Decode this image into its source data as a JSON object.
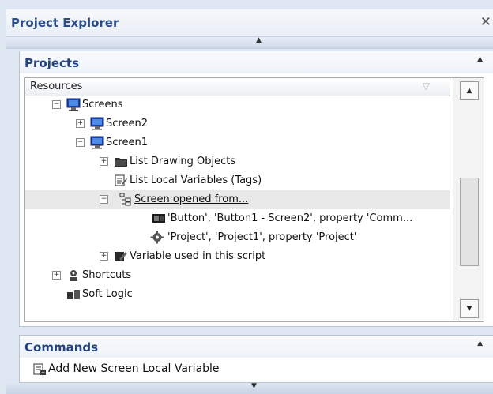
{
  "panel": {
    "title": "Project Explorer",
    "close": "✕"
  },
  "projects": {
    "title": "Projects",
    "column_header": "Resources",
    "tree": {
      "screens": "Screens",
      "screen2": "Screen2",
      "screen1": "Screen1",
      "list_drawing_objects": "List Drawing Objects",
      "list_local_variables": "List Local Variables (Tags)",
      "screen_opened_from": "Screen opened from...",
      "button_ref": "'Button', 'Button1 - Screen2', property 'Comm...",
      "project_ref": "'Project', 'Project1', property 'Project'",
      "variable_used": "Variable used in this script",
      "shortcuts": "Shortcuts",
      "soft_logic": "Soft Logic"
    }
  },
  "commands": {
    "title": "Commands",
    "items": [
      "Add New Screen Local Variable"
    ]
  },
  "arrows": {
    "up": "▲",
    "down": "▼",
    "collapse": "▲"
  },
  "colors": {
    "accent": "#23427f",
    "panel_bg": "#dfe7f3",
    "selection": "#e8e8e8"
  },
  "icons": [
    "monitor-icon",
    "folder-icon",
    "variables-icon",
    "hierarchy-icon",
    "button-icon",
    "gear-icon",
    "script-icon",
    "shortcuts-icon",
    "soft-logic-icon",
    "add-variable-icon",
    "filter-icon"
  ]
}
